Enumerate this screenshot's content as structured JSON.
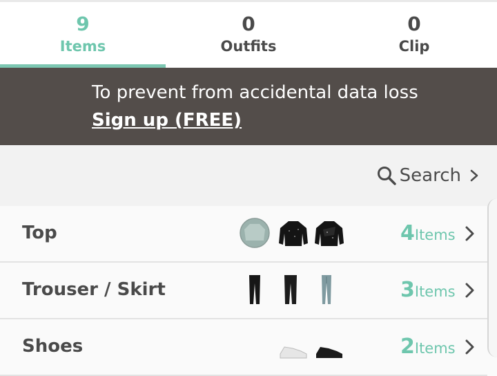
{
  "tabs": [
    {
      "count": "9",
      "label": "Items",
      "active": true
    },
    {
      "count": "0",
      "label": "Outfits",
      "active": false
    },
    {
      "count": "0",
      "label": "Clip",
      "active": false
    }
  ],
  "banner": {
    "message": "To prevent from accidental data loss",
    "link": "Sign up (FREE)"
  },
  "search": {
    "label": "Search"
  },
  "categories": [
    {
      "name": "Top",
      "count": "4",
      "unit": "Items",
      "thumbs": [
        "sweater-thumbnail",
        "black-top-thumbnail",
        "black-top-thumbnail"
      ]
    },
    {
      "name": "Trouser / Skirt",
      "count": "3",
      "unit": "Items",
      "thumbs": [
        "black-trousers-thumbnail",
        "black-trousers-thumbnail",
        "jeans-thumbnail"
      ]
    },
    {
      "name": "Shoes",
      "count": "2",
      "unit": "Items",
      "thumbs": [
        "white-sneaker-thumbnail",
        "black-sneaker-thumbnail"
      ]
    }
  ],
  "colors": {
    "accent": "#6ec6ad",
    "banner": "#534d4a",
    "text": "#4a4a4a"
  }
}
